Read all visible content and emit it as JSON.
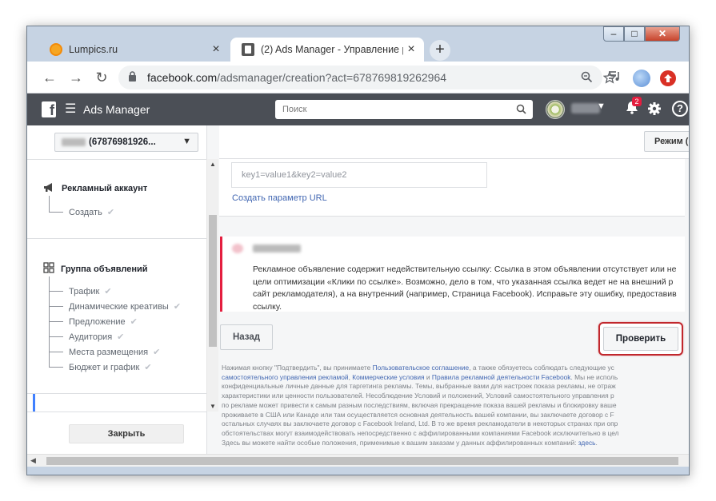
{
  "browser": {
    "tabs": [
      {
        "title": "Lumpics.ru",
        "close": "×"
      },
      {
        "title": "(2) Ads Manager - Управление р",
        "close": "×"
      }
    ],
    "new_tab": "+",
    "window_controls": {
      "minimize": "–",
      "maximize": "□",
      "close": "✕"
    },
    "nav": {
      "back": "←",
      "forward": "→",
      "reload": "↻"
    },
    "url_host": "facebook.com",
    "url_path": "/adsmanager/creation?act=678769819262964",
    "icons": [
      "zoom-icon",
      "star-icon",
      "playlist-icon",
      "profile-avatar",
      "extension-icon"
    ]
  },
  "fb": {
    "title": "Ads Manager",
    "search_placeholder": "Поиск",
    "notification_count": "2",
    "help": "?"
  },
  "sidebar": {
    "account_label": "(67876981926...",
    "sections": [
      {
        "title": "Рекламный аккаунт",
        "items": [
          "Создать"
        ]
      },
      {
        "title": "Группа объявлений",
        "items": [
          "Трафик",
          "Динамические креативы",
          "Предложение",
          "Аудитория",
          "Места размещения",
          "Бюджет и график"
        ]
      }
    ],
    "close_button": "Закрыть"
  },
  "main": {
    "mode_button": "Режим (",
    "url_param_placeholder": "key1=value1&key2=value2",
    "create_url_param": "Создать параметр URL",
    "error_text": "Рекламное объявление содержит недействительную ссылку: Ссылка в этом объявлении отсутствует или не\nцели оптимизации «Клики по ссылке». Возможно, дело в том, что указанная ссылка ведет не на внешний р\nсайт рекламодателя), а на внутренний (например, Страница Facebook). Исправьте эту ошибку, предоставив\nссылку.",
    "back_button": "Назад",
    "verify_button": "Проверить",
    "legal": {
      "l1a": "Нажимая кнопку \"Подтвердить\", вы принимаете ",
      "l1b": "Пользовательское соглашение",
      "l1c": ", а также обязуетесь соблюдать следующие ус",
      "l2a": "самостоятельного управления рекламой",
      "l2b": ", ",
      "l2c": "Коммерческие условия",
      "l2d": " и ",
      "l2e": "Правила рекламной деятельности Facebook",
      "l2f": ". Мы не исполь",
      "rest": "конфиденциальные личные данные для таргетинга рекламы. Темы, выбранные вами для настроек показа рекламы, не отраж\nхарактеристики или ценности пользователей. Несоблюдение Условий и положений, Условий самостоятельного управления р\nпо рекламе может привести к самым разным последствиям, включая прекращение показа вашей рекламы и блокировку ваше\nпроживаете в США или Канаде или там осуществляется основная деятельность вашей компании, вы заключаете договор с F\nостальных случаях вы заключаете договор с Facebook Ireland, Ltd. В то же время рекламодатели в некоторых странах при опр\nобстоятельствах могут взаимодействовать непосредственно с аффилированными компаниями Facebook исключительно в цел\nЗдесь вы можете найти особые положения, применимые к вашим заказам у данных аффилированных компаний: ",
      "here": "здесь",
      "end": "."
    }
  },
  "colors": {
    "accent": "#4267b2",
    "error": "#e41e3f",
    "highlight": "#c1272d",
    "header": "#4b4f56"
  }
}
